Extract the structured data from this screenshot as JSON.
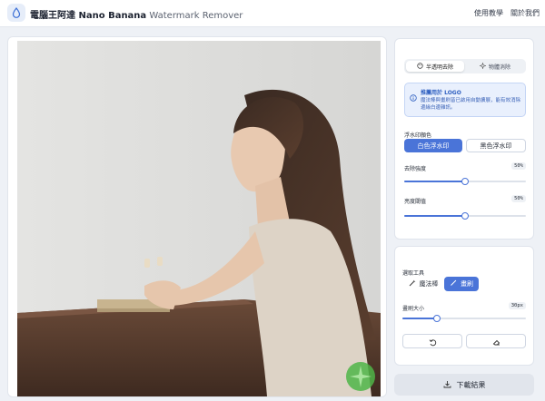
{
  "header": {
    "title_bold": "電腦王阿達 Nano Banana",
    "title_light": "Watermark Remover",
    "nav": [
      "使用教學",
      "關於我們"
    ]
  },
  "colors": {
    "accent": "#4a74d8",
    "info_bg": "#e9f0fd",
    "info_text": "#3d64b8",
    "watermark_green": "#4fb548"
  },
  "modes": {
    "tabs": [
      {
        "label": "半透明去除",
        "icon": "palette-icon",
        "active": true
      },
      {
        "label": "物體消除",
        "icon": "sparkle-icon",
        "active": false
      }
    ]
  },
  "info": {
    "title": "推薦用於 LOGO",
    "body": "魔法棒與畫刷皆已啟用自動擴展，能有效消除邊緣白邊雜訊。"
  },
  "watermark": {
    "color_label": "浮水印顏色",
    "options": [
      {
        "label": "白色浮水印",
        "selected": true
      },
      {
        "label": "黑色浮水印",
        "selected": false
      }
    ],
    "strength_label": "去除強度",
    "strength_value": "50%",
    "strength_fraction": 0.5,
    "brightness_label": "亮度閾值",
    "brightness_value": "50%",
    "brightness_fraction": 0.5
  },
  "tools": {
    "label": "選取工具",
    "items": [
      {
        "label": "魔法棒",
        "icon": "magic-wand-icon",
        "active": false
      },
      {
        "label": "畫刷",
        "icon": "brush-icon",
        "active": true
      }
    ],
    "brush_size_label": "畫刷大小",
    "brush_size_value": "30px",
    "brush_size_fraction": 0.28,
    "actions": [
      {
        "icon": "undo-icon"
      },
      {
        "icon": "eraser-icon"
      }
    ]
  },
  "download": {
    "label": "下載結果",
    "icon": "download-icon"
  }
}
